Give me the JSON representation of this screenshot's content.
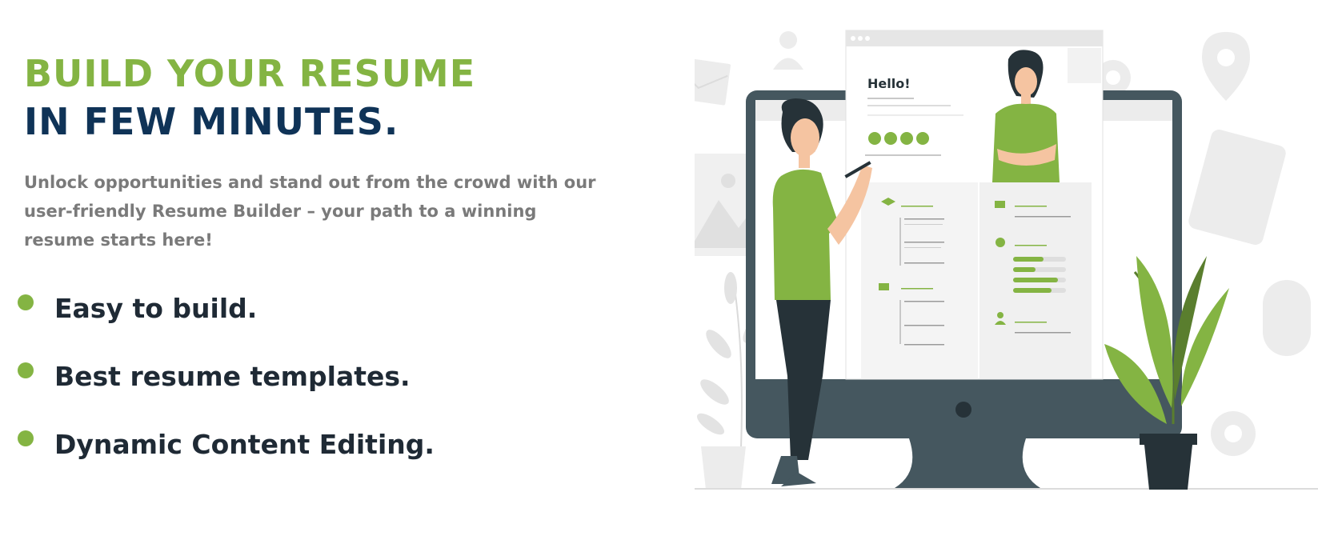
{
  "colors": {
    "accent_green": "#84b443",
    "navy": "#0f3357",
    "muted_text": "#7a7a7a",
    "dark_text": "#1f2a35",
    "monitor": "#45575f"
  },
  "hero": {
    "headline_line1": "BUILD YOUR RESUME",
    "headline_line2": "IN FEW MINUTES.",
    "subtitle": "Unlock opportunities and stand out from the crowd with our user-friendly Resume Builder – your path to a winning resume starts here!",
    "features": [
      {
        "label": "Easy to build."
      },
      {
        "label": "Best resume templates."
      },
      {
        "label": "Dynamic Content Editing."
      }
    ]
  },
  "illustration": {
    "resume_greeting": "Hello!",
    "social_icons": [
      "facebook-icon",
      "google-plus-icon",
      "instagram-icon",
      "linkedin-icon"
    ]
  }
}
